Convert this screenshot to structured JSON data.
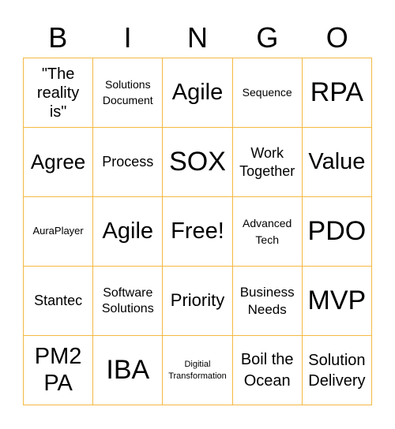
{
  "header": {
    "letters": [
      "B",
      "I",
      "N",
      "G",
      "O"
    ]
  },
  "board": {
    "border_color": "#f4b942",
    "cells": [
      [
        "\"The reality is\"",
        "Solutions Document",
        "Agile",
        "Sequence",
        "RPA"
      ],
      [
        "Agree",
        "Process",
        "SOX",
        "Work Together",
        "Value"
      ],
      [
        "AuraPlayer",
        "Agile",
        "Free!",
        "Advanced Tech",
        "PDO"
      ],
      [
        "Stantec",
        "Software Solutions",
        "Priority",
        "Business Needs",
        "MVP"
      ],
      [
        "PM2 PA",
        "IBA",
        "Digitial Transformation",
        "Boil the Ocean",
        "Solution Delivery"
      ]
    ]
  }
}
